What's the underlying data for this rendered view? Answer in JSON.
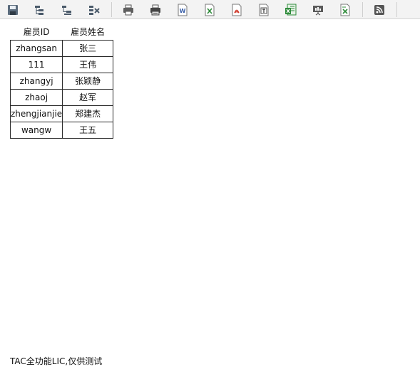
{
  "toolbar": {
    "buttons": [
      {
        "name": "save-icon"
      },
      {
        "name": "export-tree-icon"
      },
      {
        "name": "collapse-tree-icon"
      },
      {
        "name": "delete-grid-icon"
      },
      {
        "name": "print-icon"
      },
      {
        "name": "print-setup-icon"
      },
      {
        "name": "word-export-icon"
      },
      {
        "name": "excel-export-icon"
      },
      {
        "name": "pdf-export-icon"
      },
      {
        "name": "text-export-icon"
      },
      {
        "name": "excel-sheet-export-icon"
      },
      {
        "name": "presentation-icon"
      },
      {
        "name": "excel-page-export-icon"
      },
      {
        "name": "rss-icon"
      }
    ],
    "colors": {
      "word": "#3a5fa8",
      "excel": "#2e8b3a",
      "pdf": "#d0392b",
      "rss": "#555555"
    }
  },
  "table": {
    "headers": [
      "雇员ID",
      "雇员姓名"
    ],
    "rows": [
      [
        "zhangsan",
        "张三"
      ],
      [
        "111",
        "王伟"
      ],
      [
        "zhangyj",
        "张颖静"
      ],
      [
        "zhaoj",
        "赵军"
      ],
      [
        "zhengjianjie",
        "郑建杰"
      ],
      [
        "wangw",
        "王五"
      ]
    ]
  },
  "footer": {
    "text": "TAC全功能LIC,仅供测试"
  }
}
